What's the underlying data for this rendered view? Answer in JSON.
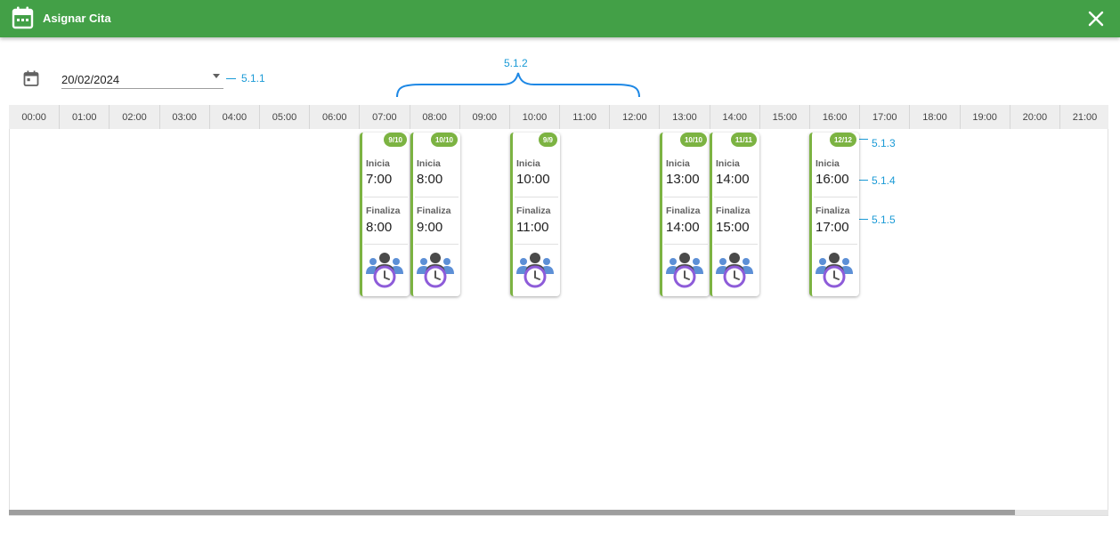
{
  "header": {
    "title": "Asignar Cita",
    "bg_color": "#43a047",
    "icon": "calendar-icon",
    "close_icon": "close-icon"
  },
  "date_picker": {
    "icon": "calendar-icon",
    "value": "20/02/2024"
  },
  "annotations": {
    "a1": "5.1.1",
    "a2": "5.1.2",
    "a3": "5.1.3",
    "a4": "5.1.4",
    "a5": "5.1.5",
    "color": "#1a9ad6"
  },
  "hours": [
    "00:00",
    "01:00",
    "02:00",
    "03:00",
    "04:00",
    "05:00",
    "06:00",
    "07:00",
    "08:00",
    "09:00",
    "10:00",
    "11:00",
    "12:00",
    "13:00",
    "14:00",
    "15:00",
    "16:00",
    "17:00",
    "18:00",
    "19:00",
    "20:00",
    "21:00"
  ],
  "slots": [
    {
      "badge": "9/10",
      "start_label": "Inicia",
      "start": "7:00",
      "end_label": "Finaliza",
      "end": "8:00"
    },
    {
      "badge": "10/10",
      "start_label": "Inicia",
      "start": "8:00",
      "end_label": "Finaliza",
      "end": "9:00"
    },
    {
      "badge": "9/9",
      "start_label": "Inicia",
      "start": "10:00",
      "end_label": "Finaliza",
      "end": "11:00"
    },
    {
      "badge": "10/10",
      "start_label": "Inicia",
      "start": "13:00",
      "end_label": "Finaliza",
      "end": "14:00"
    },
    {
      "badge": "11/11",
      "start_label": "Inicia",
      "start": "14:00",
      "end_label": "Finaliza",
      "end": "15:00"
    },
    {
      "badge": "12/12",
      "start_label": "Inicia",
      "start": "16:00",
      "end_label": "Finaliza",
      "end": "17:00"
    }
  ],
  "slot_icon": "group-clock-icon",
  "accent_color": "#7cb342"
}
